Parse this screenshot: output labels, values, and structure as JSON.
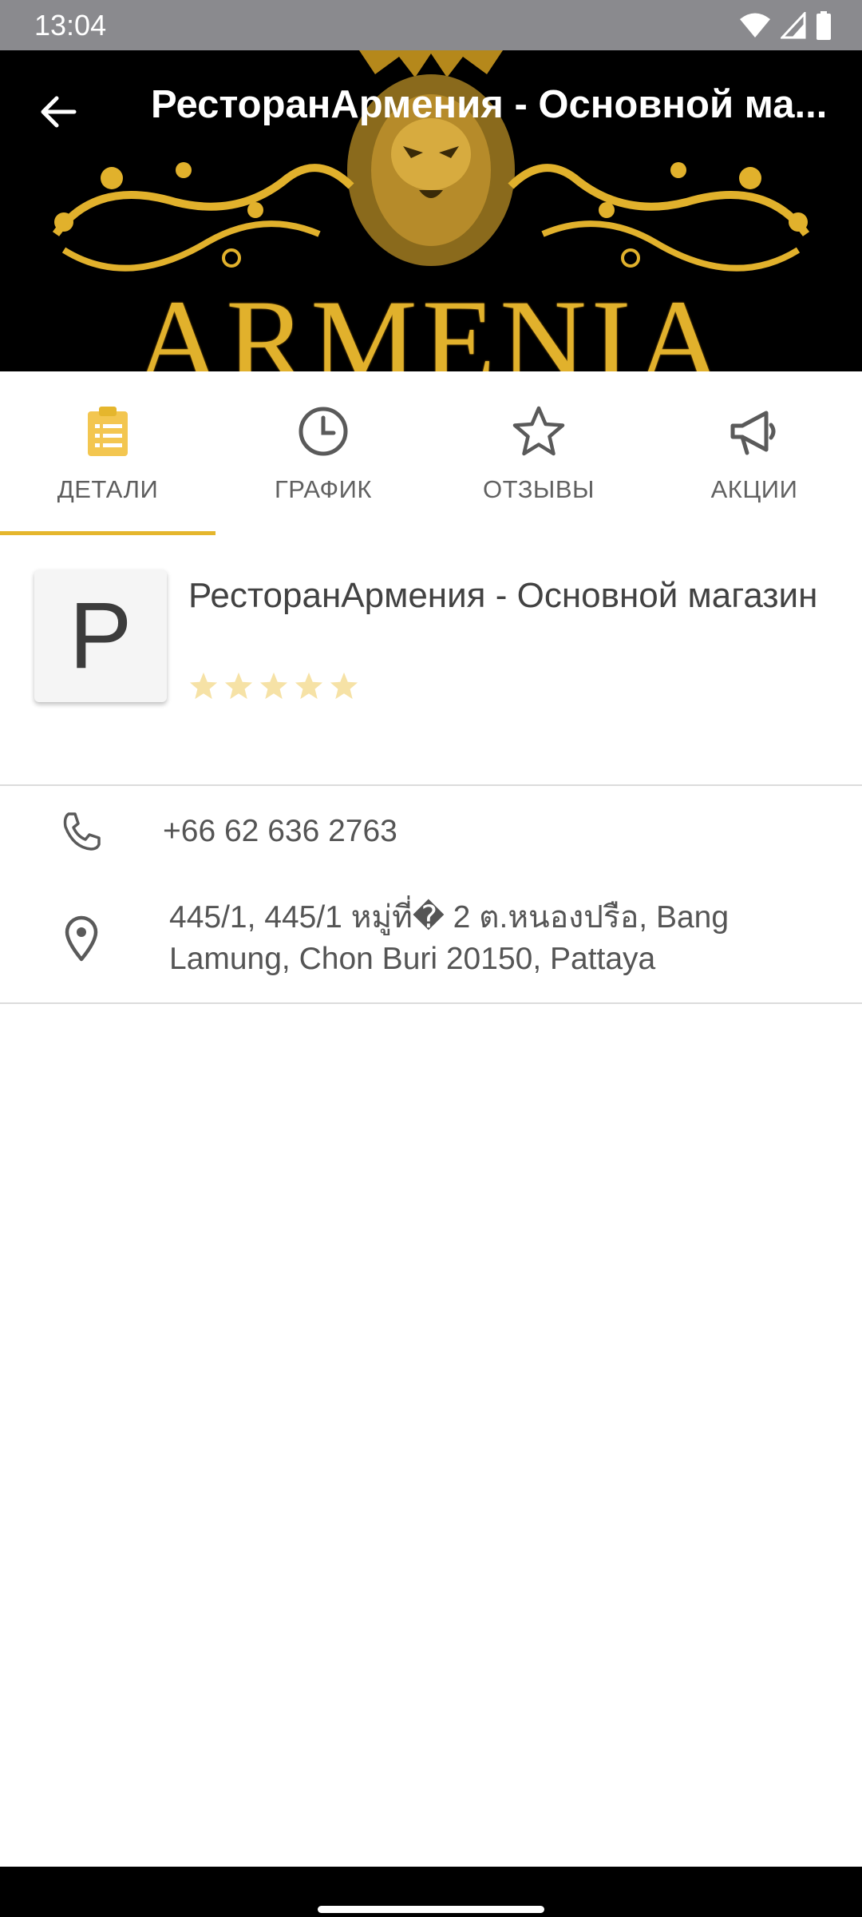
{
  "status_bar": {
    "time": "13:04",
    "icons": [
      "wifi-icon",
      "signal-icon",
      "battery-icon"
    ]
  },
  "header": {
    "title": "РесторанАрмения - Основной ма...",
    "back_icon": "arrow-left-icon",
    "banner_brand": "ARMENIA",
    "banner_colors": {
      "background": "#000000",
      "gold": "#e1b12c"
    }
  },
  "tabs": [
    {
      "label": "ДЕТАЛИ",
      "icon": "clipboard-list-icon",
      "active": true
    },
    {
      "label": "ГРАФИК",
      "icon": "clock-icon",
      "active": false
    },
    {
      "label": "ОТЗЫВЫ",
      "icon": "star-outline-icon",
      "active": false
    },
    {
      "label": "АКЦИИ",
      "icon": "megaphone-icon",
      "active": false
    }
  ],
  "store": {
    "avatar_letter": "P",
    "name": "РесторанАрмения - Основной магазин",
    "rating": 0,
    "rating_max": 5
  },
  "contact": {
    "phone": "+66 62 636 2763",
    "address": "445/1, 445/1 หมู่ที่� 2 ต.หนองปรือ, Bang Lamung, Chon Buri 20150, Pattaya"
  },
  "colors": {
    "accent": "#e5b62d",
    "star_empty": "#f6e2a6",
    "text_primary": "#424242",
    "text_secondary": "#555555"
  }
}
